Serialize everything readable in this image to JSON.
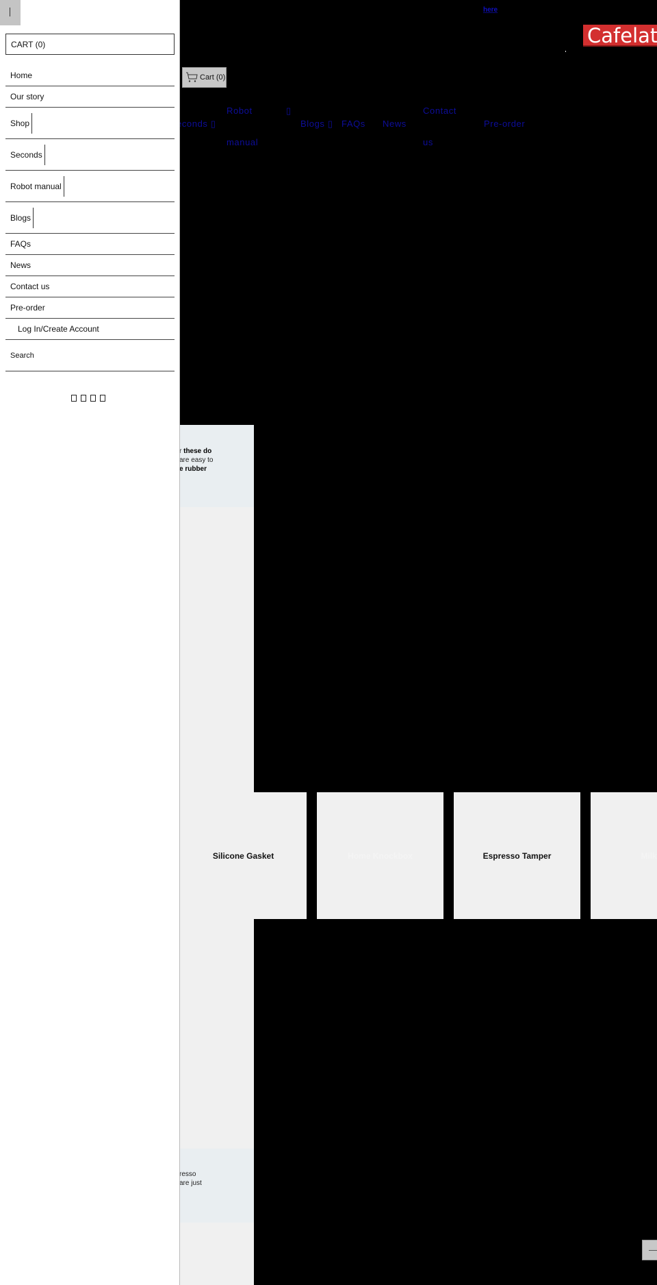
{
  "announcement": {
    "link_text": "here"
  },
  "header": {
    "logo_text": "Cafelat",
    "brand_color": "#d32f2f",
    "cart_label": "Cart (0)",
    "cart_icon": "shopping-cart-icon"
  },
  "top_nav": {
    "link_color": "#0d0d9a",
    "items": [
      {
        "label": "Seconds ▯",
        "visible_fragment": "econds ▯"
      },
      {
        "label": "Robot"
      },
      {
        "label": "manual"
      },
      {
        "label": "▯"
      },
      {
        "label": "Blogs ▯"
      },
      {
        "label": "FAQs"
      },
      {
        "label": "News"
      },
      {
        "label": "Contact"
      },
      {
        "label": "us"
      },
      {
        "label": "Pre-order"
      }
    ]
  },
  "promo_top": {
    "line1_prefix": "r ",
    "line1_bold": "these do",
    "line2": "are easy to",
    "line3_bold": "e rubber"
  },
  "promo_bottom": {
    "line1": "resso",
    "line2": "are just"
  },
  "products": [
    {
      "name": "Silicone Gasket"
    },
    {
      "name": "Home Knockbox"
    },
    {
      "name": "Espresso Tamper"
    },
    {
      "name": "Milk Pi"
    }
  ],
  "drawer": {
    "toggle_icon": "menu-toggle-icon",
    "cart_label": "CART (0)",
    "menu": [
      {
        "label": "Home",
        "has_submenu": false
      },
      {
        "label": "Our story",
        "has_submenu": false
      },
      {
        "label": "Shop",
        "has_submenu": true
      },
      {
        "label": "Seconds",
        "has_submenu": true
      },
      {
        "label": "Robot manual",
        "has_submenu": true
      },
      {
        "label": "Blogs",
        "has_submenu": true
      },
      {
        "label": "FAQs",
        "has_submenu": false
      },
      {
        "label": "News",
        "has_submenu": false
      },
      {
        "label": "Contact us",
        "has_submenu": false
      },
      {
        "label": "Pre-order",
        "has_submenu": false
      }
    ],
    "account_label": "Log In/Create Account",
    "search_label": "Search",
    "social_icons": [
      "social-icon-1",
      "social-icon-2",
      "social-icon-3",
      "social-icon-4"
    ]
  }
}
